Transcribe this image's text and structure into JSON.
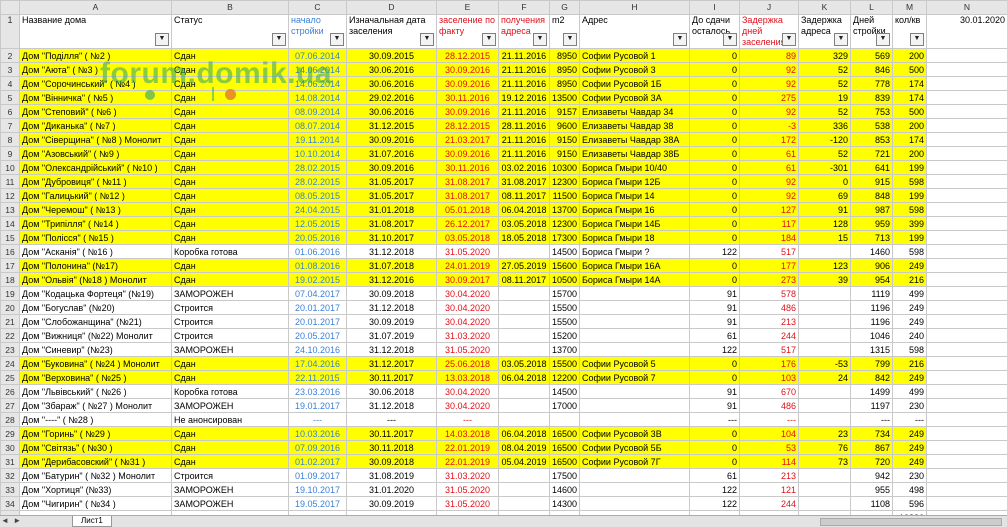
{
  "columns": [
    "A",
    "B",
    "C",
    "D",
    "E",
    "F",
    "G",
    "H",
    "I",
    "J",
    "K",
    "L",
    "M",
    "N"
  ],
  "headers": {
    "A": "Название дома",
    "B": "Статус",
    "C": "начало стройки",
    "D": "Изначальная дата заселения",
    "E": "заселение по факту",
    "F": "получения адреса",
    "G": "m2",
    "H": "Адрес",
    "I": "До сдачи осталось",
    "J": "Задержка дней заселения",
    "K": "Задержка адреса",
    "L": "Дней стройки",
    "M": "кол/кв",
    "N": "30.01.2020"
  },
  "rows": [
    {
      "n": "2",
      "hl": true,
      "a": "Дом \"Поділля\" ( №2 )",
      "b": "Сдан",
      "c": "07.06.2014",
      "d": "30.09.2015",
      "e": "28.12.2015",
      "f": "21.11.2016",
      "g": "8950",
      "h": "Софии Русовой 1",
      "i": "0",
      "j": "89",
      "k": "329",
      "l": "569",
      "m": "200"
    },
    {
      "n": "3",
      "hl": true,
      "a": "Дом \"Аюта\" ( №3 )",
      "b": "Сдан",
      "c": "14.06.2014",
      "d": "30.06.2016",
      "e": "30.09.2016",
      "f": "21.11.2016",
      "g": "8950",
      "h": "Софии Русовой 3",
      "i": "0",
      "j": "92",
      "k": "52",
      "l": "846",
      "m": "500"
    },
    {
      "n": "4",
      "hl": true,
      "a": "Дом \"Сорочинський\" ( №4 )",
      "b": "Сдан",
      "c": "14.06.2014",
      "d": "30.06.2016",
      "e": "30.09.2016",
      "f": "21.11.2016",
      "g": "8950",
      "h": "Софии Русовой 1Б",
      "i": "0",
      "j": "92",
      "k": "52",
      "l": "778",
      "m": "174"
    },
    {
      "n": "5",
      "hl": true,
      "a": "Дом \"Вінничка\" ( №5 )",
      "b": "Сдан",
      "c": "14.08.2014",
      "d": "29.02.2016",
      "e": "30.11.2016",
      "f": "19.12.2016",
      "g": "13500",
      "h": "Софии Русовой 3А",
      "i": "0",
      "j": "275",
      "k": "19",
      "l": "839",
      "m": "174"
    },
    {
      "n": "6",
      "hl": true,
      "a": "Дом \"Степовий\" ( №6 )",
      "b": "Сдан",
      "c": "08.09.2014",
      "d": "30.06.2016",
      "e": "30.09.2016",
      "f": "21.11.2016",
      "g": "9157",
      "h": "Елизаветы Чавдар 34",
      "i": "0",
      "j": "92",
      "k": "52",
      "l": "753",
      "m": "500"
    },
    {
      "n": "7",
      "hl": true,
      "a": "Дом \"Диканька\" ( №7 )",
      "b": "Сдан",
      "c": "08.07.2014",
      "d": "31.12.2015",
      "e": "28.12.2015",
      "f": "28.11.2016",
      "g": "9600",
      "h": "Елизаветы Чавдар 38",
      "i": "0",
      "j": "-3",
      "k": "336",
      "l": "538",
      "m": "200"
    },
    {
      "n": "8",
      "hl": true,
      "a": "Дом \"Сіверщина\" ( №8 ) Монолит",
      "b": "Сдан",
      "c": "19.11.2014",
      "d": "30.09.2016",
      "e": "21.03.2017",
      "f": "21.11.2016",
      "g": "9150",
      "h": "Елизаветы Чавдар 38А",
      "i": "0",
      "j": "172",
      "k": "-120",
      "l": "853",
      "m": "174"
    },
    {
      "n": "9",
      "hl": true,
      "a": "Дом \"Азовський\" ( №9 )",
      "b": "Сдан",
      "c": "10.10.2014",
      "d": "31.07.2016",
      "e": "30.09.2016",
      "f": "21.11.2016",
      "g": "9150",
      "h": "Елизаветы Чавдар 38Б",
      "i": "0",
      "j": "61",
      "k": "52",
      "l": "721",
      "m": "200"
    },
    {
      "n": "10",
      "hl": true,
      "a": "Дом \"Олександрійський\" ( №10 )",
      "b": "Сдан",
      "c": "28.02.2015",
      "d": "30.09.2016",
      "e": "30.11.2016",
      "f": "03.02.2016",
      "g": "10300",
      "h": "Бориса Гмыри 10/40",
      "i": "0",
      "j": "61",
      "k": "-301",
      "l": "641",
      "m": "199"
    },
    {
      "n": "11",
      "hl": true,
      "a": "Дом \"Дубровиця\" ( №11 )",
      "b": "Сдан",
      "c": "28.02.2015",
      "d": "31.05.2017",
      "e": "31.08.2017",
      "f": "31.08.2017",
      "g": "12300",
      "h": "Бориса Гмыри 12Б",
      "i": "0",
      "j": "92",
      "k": "0",
      "l": "915",
      "m": "598"
    },
    {
      "n": "12",
      "hl": true,
      "a": "Дом \"Галицький\" ( №12 )",
      "b": "Сдан",
      "c": "08.05.2015",
      "d": "31.05.2017",
      "e": "31.08.2017",
      "f": "08.11.2017",
      "g": "11500",
      "h": "Бориса Гмыри 14",
      "i": "0",
      "j": "92",
      "k": "69",
      "l": "848",
      "m": "199"
    },
    {
      "n": "13",
      "hl": true,
      "a": "Дом \"Черемош\" ( №13 )",
      "b": "Сдан",
      "c": "24.04.2015",
      "d": "31.01.2018",
      "e": "05.01.2018",
      "f": "06.04.2018",
      "g": "13700",
      "h": "Бориса Гмыри 16",
      "i": "0",
      "j": "127",
      "k": "91",
      "l": "987",
      "m": "598"
    },
    {
      "n": "14",
      "hl": true,
      "a": "Дом \"Трипілля\" ( №14 )",
      "b": "Сдан",
      "c": "12.05.2015",
      "d": "31.08.2017",
      "e": "26.12.2017",
      "f": "03.05.2018",
      "g": "12300",
      "h": "Бориса Гмыри 14Б",
      "i": "0",
      "j": "117",
      "k": "128",
      "l": "959",
      "m": "399"
    },
    {
      "n": "15",
      "hl": true,
      "a": "Дом \"Полісся\" ( №15 )",
      "b": "Сдан",
      "c": "20.05.2016",
      "d": "31.10.2017",
      "e": "03.05.2018",
      "f": "18.05.2018",
      "g": "17300",
      "h": "Бориса Гмыри 18",
      "i": "0",
      "j": "184",
      "k": "15",
      "l": "713",
      "m": "199"
    },
    {
      "n": "16",
      "hl": false,
      "a": "Дом \"Асканія\" ( №16 )",
      "b": "Коробка готова",
      "c": "01.06.2016",
      "d": "31.12.2018",
      "e": "31.05.2020",
      "f": "",
      "g": "14500",
      "h": "Бориса Гмыри ?",
      "i": "122",
      "j": "517",
      "k": "",
      "l": "1460",
      "m": "598"
    },
    {
      "n": "17",
      "hl": true,
      "a": "Дом \"Полонина\" (№17)",
      "b": "Сдан",
      "c": "01.08.2016",
      "d": "31.07.2018",
      "e": "24.01.2019",
      "f": "27.05.2019",
      "g": "15600",
      "h": "Бориса Гмыри 16А",
      "i": "0",
      "j": "177",
      "k": "123",
      "l": "906",
      "m": "249"
    },
    {
      "n": "18",
      "hl": true,
      "a": "Дом \"Ольвія\" (№18 ) Монолит",
      "b": "Сдан",
      "c": "19.02.2015",
      "d": "31.12.2016",
      "e": "30.09.2017",
      "f": "08.11.2017",
      "g": "10500",
      "h": "Бориса Гмыри 14А",
      "i": "0",
      "j": "273",
      "k": "39",
      "l": "954",
      "m": "216"
    },
    {
      "n": "19",
      "hl": false,
      "a": "Дом \"Кодацька Фортеця\" (№19)",
      "b": "ЗАМОРОЖЕН",
      "c": "07.04.2017",
      "d": "30.09.2018",
      "e": "30.04.2020",
      "f": "",
      "g": "15700",
      "h": "",
      "i": "91",
      "j": "578",
      "k": "",
      "l": "1119",
      "m": "499"
    },
    {
      "n": "20",
      "hl": false,
      "a": "Дом \"Богуслав\" (№20)",
      "b": "Строится",
      "c": "20.01.2017",
      "d": "31.12.2018",
      "e": "30.04.2020",
      "f": "",
      "g": "15500",
      "h": "",
      "i": "91",
      "j": "486",
      "k": "",
      "l": "1196",
      "m": "249"
    },
    {
      "n": "21",
      "hl": false,
      "a": "Дом \"Слобожанщина\" (№21)",
      "b": "Строится",
      "c": "20.01.2017",
      "d": "30.09.2019",
      "e": "30.04.2020",
      "f": "",
      "g": "15500",
      "h": "",
      "i": "91",
      "j": "213",
      "k": "",
      "l": "1196",
      "m": "249"
    },
    {
      "n": "22",
      "hl": false,
      "a": "Дом \"Вижниця\" (№22) Монолит",
      "b": "Строится",
      "c": "20.05.2017",
      "d": "31.07.2019",
      "e": "31.03.2020",
      "f": "",
      "g": "15200",
      "h": "",
      "i": "61",
      "j": "244",
      "k": "",
      "l": "1046",
      "m": "240"
    },
    {
      "n": "23",
      "hl": false,
      "a": "Дом \"Синевир\" (№23)",
      "b": "ЗАМОРОЖЕН",
      "c": "24.10.2016",
      "d": "31.12.2018",
      "e": "31.05.2020",
      "f": "",
      "g": "13700",
      "h": "",
      "i": "122",
      "j": "517",
      "k": "",
      "l": "1315",
      "m": "598"
    },
    {
      "n": "24",
      "hl": true,
      "a": "Дом \"Буковина\" ( №24 ) Монолит",
      "b": "Сдан",
      "c": "17.04.2016",
      "d": "31.12.2017",
      "e": "25.06.2018",
      "f": "03.05.2018",
      "g": "15500",
      "h": "Софии Русовой 5",
      "i": "0",
      "j": "176",
      "k": "-53",
      "l": "799",
      "m": "216"
    },
    {
      "n": "25",
      "hl": true,
      "a": "Дом \"Верховина\" ( №25 )",
      "b": "Сдан",
      "c": "22.11.2015",
      "d": "30.11.2017",
      "e": "13.03.2018",
      "f": "06.04.2018",
      "g": "12200",
      "h": "Софии Русовой 7",
      "i": "0",
      "j": "103",
      "k": "24",
      "l": "842",
      "m": "249"
    },
    {
      "n": "26",
      "hl": false,
      "a": "Дом \"Львівський\" ( №26 )",
      "b": "Коробка готова",
      "c": "23.03.2016",
      "d": "30.06.2018",
      "e": "30.04.2020",
      "f": "",
      "g": "14500",
      "h": "",
      "i": "91",
      "j": "670",
      "k": "",
      "l": "1499",
      "m": "499"
    },
    {
      "n": "27",
      "hl": false,
      "a": "Дом \"Збараж\" ( №27 ) Монолит",
      "b": "ЗАМОРОЖЕН",
      "c": "19.01.2017",
      "d": "31.12.2018",
      "e": "30.04.2020",
      "f": "",
      "g": "17000",
      "h": "",
      "i": "91",
      "j": "486",
      "k": "",
      "l": "1197",
      "m": "230"
    },
    {
      "n": "28",
      "hl": false,
      "a": "Дом \"----\" ( №28 )",
      "b": "Не анонсирован",
      "c": "---",
      "d": "---",
      "e": "---",
      "f": "",
      "g": "",
      "h": "",
      "i": "---",
      "j": "---",
      "k": "",
      "l": "---",
      "m": "---"
    },
    {
      "n": "29",
      "hl": true,
      "a": "Дом \"Горинь\" ( №29 )",
      "b": "Сдан",
      "c": "10.03.2016",
      "d": "30.11.2017",
      "e": "14.03.2018",
      "f": "06.04.2018",
      "g": "16500",
      "h": "Софии Русовой 3В",
      "i": "0",
      "j": "104",
      "k": "23",
      "l": "734",
      "m": "249"
    },
    {
      "n": "30",
      "hl": true,
      "a": "Дом \"Світязь\" ( №30 )",
      "b": "Сдан",
      "c": "07.09.2016",
      "d": "30.11.2018",
      "e": "22.01.2019",
      "f": "08.04.2019",
      "g": "16500",
      "h": "Софии Русовой 5Б",
      "i": "0",
      "j": "53",
      "k": "76",
      "l": "867",
      "m": "249"
    },
    {
      "n": "31",
      "hl": true,
      "a": "Дом \"Дерибасовский\" ( №31 )",
      "b": "Сдан",
      "c": "01.02.2017",
      "d": "30.09.2018",
      "e": "22.01.2019",
      "f": "05.04.2019",
      "g": "16500",
      "h": "Софии Русовой 7Г",
      "i": "0",
      "j": "114",
      "k": "73",
      "l": "720",
      "m": "249"
    },
    {
      "n": "32",
      "hl": false,
      "a": "Дом \"Батурин\" ( №32 ) Монолит",
      "b": "Строится",
      "c": "01.09.2017",
      "d": "31.08.2019",
      "e": "31.03.2020",
      "f": "",
      "g": "17500",
      "h": "",
      "i": "61",
      "j": "213",
      "k": "",
      "l": "942",
      "m": "230"
    },
    {
      "n": "33",
      "hl": false,
      "a": "Дом \"Хортиця\" (№33)",
      "b": "ЗАМОРОЖЕН",
      "c": "19.10.2017",
      "d": "31.01.2020",
      "e": "31.05.2020",
      "f": "",
      "g": "14600",
      "h": "",
      "i": "122",
      "j": "121",
      "k": "",
      "l": "955",
      "m": "498"
    },
    {
      "n": "34",
      "hl": false,
      "a": "Дом \"Чигирин\" ( №34 )",
      "b": "ЗАМОРОЖЕН",
      "c": "19.05.2017",
      "d": "30.09.2019",
      "e": "31.05.2020",
      "f": "",
      "g": "14300",
      "h": "",
      "i": "122",
      "j": "244",
      "k": "",
      "l": "1108",
      "m": "596"
    },
    {
      "n": "35",
      "hl": false,
      "a": "",
      "b": "",
      "c": "",
      "d": "",
      "e": "",
      "f": "",
      "g": "",
      "h": "",
      "i": "",
      "j": "",
      "k": "",
      "l": "",
      "m": "10826"
    }
  ],
  "watermark": "forum.domik.ua",
  "tabbar": {
    "nav": [
      "◄",
      "►"
    ],
    "sheet_tab": "Лист1"
  },
  "colors": {
    "highlight": "#ffff00",
    "blue_text": "#3a7fd6",
    "red_text": "#e0101a",
    "watermark_green": "#2ca06e",
    "watermark_orange": "#e67828"
  },
  "icons": {
    "filter": "filter-dropdown-icon"
  }
}
